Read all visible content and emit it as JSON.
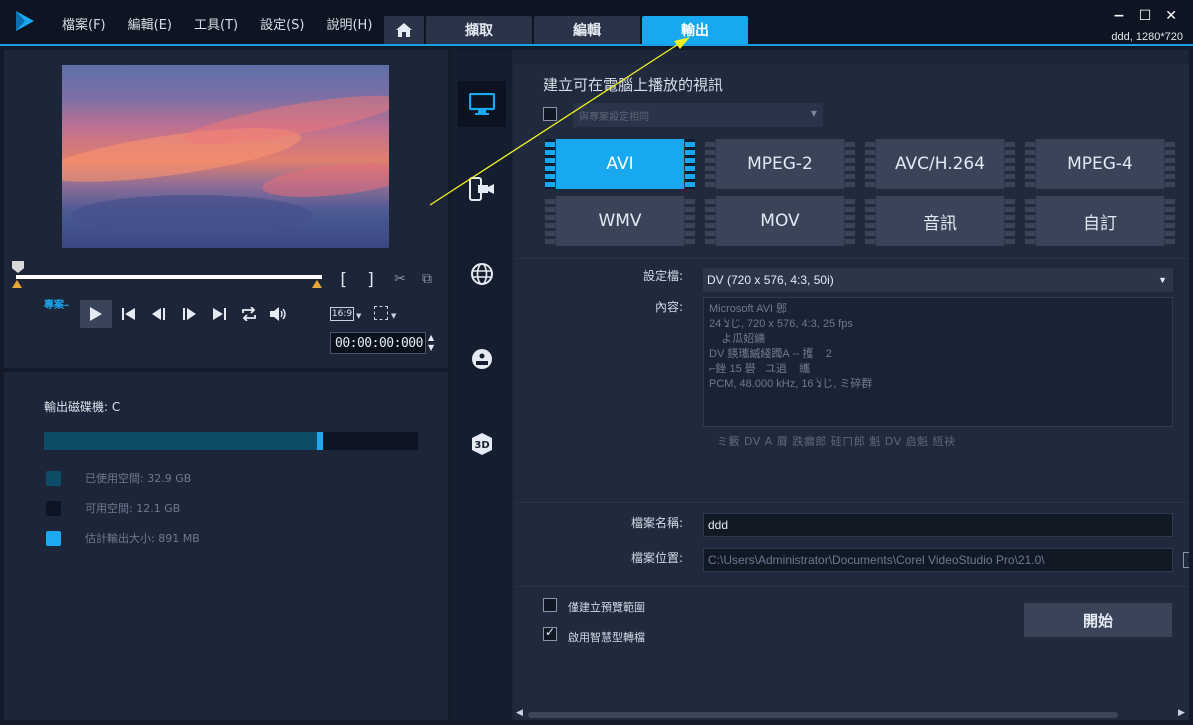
{
  "menu": {
    "items": [
      "檔案(F)",
      "編輯(E)",
      "工具(T)",
      "設定(S)",
      "說明(H)"
    ]
  },
  "tabs": {
    "home_icon": "home-icon",
    "items": [
      {
        "label": "擷取",
        "active": false
      },
      {
        "label": "編輯",
        "active": false
      },
      {
        "label": "輸出",
        "active": true
      }
    ]
  },
  "window": {
    "project_info": "ddd, 1280*720",
    "minimize": "−",
    "maximize": "☐",
    "close": "✕"
  },
  "player": {
    "mark_in": "[",
    "mark_out": "]",
    "project_label": "專案",
    "aspect": "16:9",
    "timecode": "00:00:00:000"
  },
  "disk": {
    "title": "輸出磁碟機: C",
    "used_fraction": 0.729,
    "estimate_fraction": 0.745,
    "legend": [
      {
        "label": "已使用空間:  32.9 GB",
        "color": "#0e4d67"
      },
      {
        "label": "可用空間:  12.1 GB",
        "color": "#0d1524"
      },
      {
        "label": "估計輸出大小:  891 MB",
        "color": "#1ba9f2"
      }
    ]
  },
  "sidebar": {
    "icons": [
      "computer-icon",
      "device-icon",
      "web-icon",
      "disc-icon",
      "3d-icon"
    ],
    "active": 0
  },
  "output": {
    "section_title": "建立可在電腦上播放的視訊",
    "preset_placeholder": "與專案設定相同",
    "formats": [
      {
        "label": "AVI",
        "active": true
      },
      {
        "label": "MPEG-2",
        "active": false
      },
      {
        "label": "AVC/H.264",
        "active": false
      },
      {
        "label": "MPEG-4",
        "active": false
      },
      {
        "label": "WMV",
        "active": false
      },
      {
        "label": "MOV",
        "active": false
      },
      {
        "label": "音訊",
        "active": false
      },
      {
        "label": "自訂",
        "active": false
      }
    ],
    "profile_label": "設定檔:",
    "profile_value": "DV (720 x 576, 4:3, 50i)",
    "content_label": "內容:",
    "content_lines": "Microsoft AVI 鄎\n24 ﻽じ, 720 x 576, 4:3, 25 fps\n    よ瓜妱纊\nDV 鍈瓗縬綫躅A -- 擭    2\n⌐銼 15 礐   ユ逍    纗\nPCM, 48.000 kHz, 16 ﻽じ, ミ碎群",
    "options_row": "ミ籔 DV    A    脣    跌瘺郎        硅ㄇ郎        魁    DV 启魁    絚袂",
    "filename_label": "檔案名稱:",
    "filename_value": "ddd",
    "location_label": "檔案位置:",
    "location_value": "C:\\Users\\Administrator\\Documents\\Corel VideoStudio Pro\\21.0\\",
    "preview_range_label": "僅建立預覽範圍",
    "preview_range_checked": false,
    "smart_render_label": "啟用智慧型轉檔",
    "smart_render_checked": true,
    "start_label": "開始"
  },
  "colors": {
    "accent": "#17a8f0",
    "annotation": "#f2f020"
  }
}
